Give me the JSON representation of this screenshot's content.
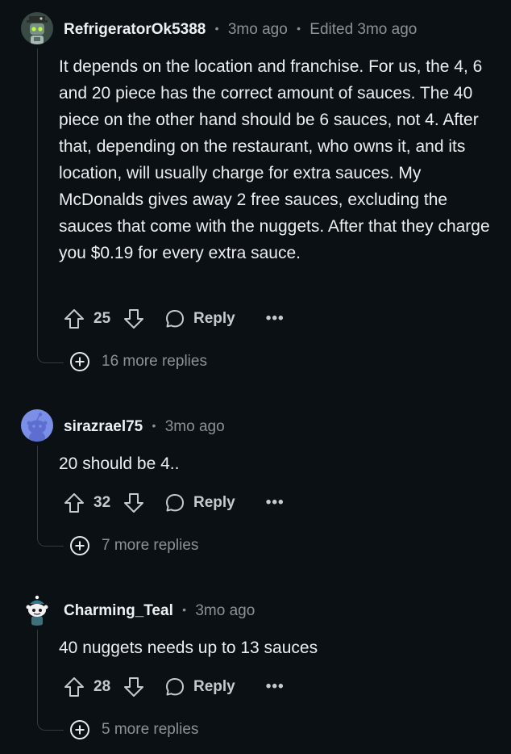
{
  "comments": [
    {
      "author": "RefrigeratorOk5388",
      "time": "3mo ago",
      "edited": "Edited 3mo ago",
      "avatar_icon": "robot-avatar-icon",
      "body": "It depends on the location and franchise. For us, the 4, 6 and 20 piece has the correct amount of sauces. The 40 piece on the other hand should be 6 sauces, not 4. After that, depending on the restaurant, who owns it, and its location, will usually charge for extra sauces. My McDonalds gives away 2 free sauces, excluding the sauces that come with the nuggets. After that they charge you $0.19 for every extra sauce.",
      "score": "25",
      "reply_label": "Reply",
      "more_label": "•••",
      "more_replies": "16 more replies"
    },
    {
      "author": "sirazrael75",
      "time": "3mo ago",
      "avatar_icon": "snoo-avatar-icon",
      "body": "20 should be 4..",
      "score": "32",
      "reply_label": "Reply",
      "more_label": "•••",
      "more_replies": "7 more replies"
    },
    {
      "author": "Charming_Teal",
      "time": "3mo ago",
      "avatar_icon": "snoo-teal-avatar-icon",
      "body": "40 nuggets needs up to 13 sauces",
      "score": "28",
      "reply_label": "Reply",
      "more_label": "•••",
      "more_replies": "5 more replies"
    }
  ],
  "colors": {
    "background": "#0b1014",
    "thread_line": "#343a3f",
    "muted_text": "#8b9296",
    "body_text": "#eceff1"
  }
}
